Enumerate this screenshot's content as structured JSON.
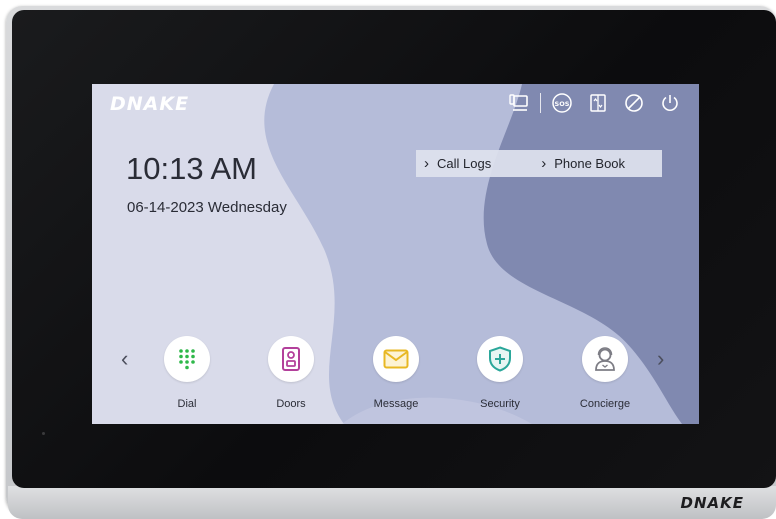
{
  "device": {
    "brand": "DNAKE",
    "hardware_logo": "DNAKE"
  },
  "status_bar": {
    "icons": [
      "monitor-icon",
      "sos-icon",
      "elevator-icon",
      "do-not-disturb-icon",
      "power-icon"
    ],
    "sos_text": "SOS"
  },
  "clock": {
    "time": "10:13 AM",
    "date": "06-14-2023 Wednesday"
  },
  "quick_links": {
    "call_logs": "Call Logs",
    "phone_book": "Phone Book"
  },
  "apps": [
    {
      "label": "Dial",
      "icon": "dialpad-icon",
      "color": "#2fb84a"
    },
    {
      "label": "Doors",
      "icon": "door-station-icon",
      "color": "#b3409b"
    },
    {
      "label": "Message",
      "icon": "envelope-icon",
      "color": "#e8b824"
    },
    {
      "label": "Security",
      "icon": "shield-plus-icon",
      "color": "#2aa79a"
    },
    {
      "label": "Concierge",
      "icon": "concierge-person-icon",
      "color": "#7d7d85"
    }
  ],
  "nav": {
    "prev": "‹",
    "next": "›"
  },
  "colors": {
    "screen_bg": "#d8dae9",
    "wave_mid": "#b4bbd8",
    "wave_dark": "#7f8aaf"
  }
}
